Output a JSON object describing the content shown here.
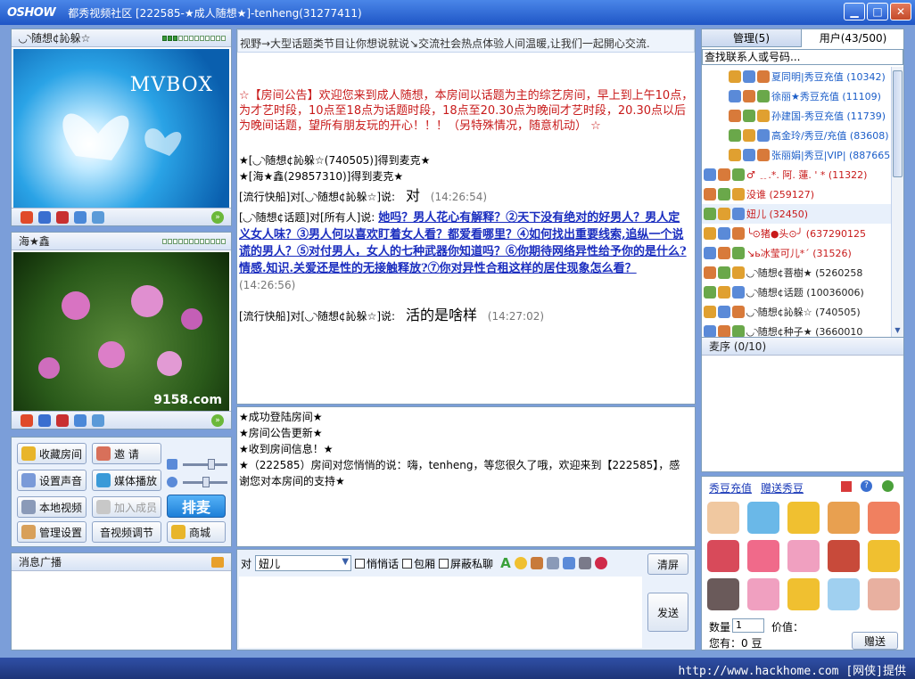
{
  "window": {
    "logo": "OSHOW",
    "title": "都秀视频社区  [222585-★成人随想★]-tenheng(31277411)",
    "buttons": [
      "▁",
      "□",
      "✕"
    ]
  },
  "video1": {
    "name": "◟◞◝随想¢訫躲☆",
    "watermark": "MVBOX"
  },
  "video2": {
    "name": "海★鑫",
    "watermark": "9158.com"
  },
  "buttons": {
    "favorite_room": "收藏房间",
    "invite": "邀   请",
    "sound_settings": "设置声音",
    "media_play": "媒体播放",
    "local_video": "本地视频",
    "join_member": "加入成员",
    "queue_mic": "排麦",
    "manage_settings": "管理设置",
    "av_adjust": "音视频调节",
    "mall": "商城"
  },
  "broadcast": {
    "title": "消息广播"
  },
  "marquee": "视野→大型话题类节目让你想说就说↘交流社会热点体验人间温暖,让我们一起開心交流.",
  "chat": {
    "announcement": "☆【房间公告】欢迎您来到成人随想，本房间以话题为主的综艺房间，早上到上午10点，为才艺时段，10点至18点为话题时段，18点至20.30点为晚间才艺时段，20.30点以后为晚间话题，望所有朋友玩的开心！！！（另特殊情况，随意机动） ☆",
    "mic1": "★[◟◞◝随想¢訫躲☆(740505)]得到麦克★",
    "mic2": "★[海★鑫(29857310)]得到麦克★",
    "msg1_prefix": "[流行快船]对[◟◞◝随想¢訫躲☆]说:",
    "msg1_text": "对",
    "msg1_time": "(14:26:54)",
    "msg2_prefix": "[◟◞◝随想¢话题]对[所有人]说:",
    "msg2_text": "她吗？男人花心有解释？②天下没有绝对的好男人？男人定义女人味？③男人何以喜欢盯着女人看？都爱看哪里？④如何找出重要线索,追纵一个说谎的男人？⑤对付男人，女人的七种武器你知道吗？⑥你期待网络异性给予你的是什么?情感.知识.关爱还是性的无接触释放?⑦你对异性合租这样的居住现象怎么看？",
    "msg2_time": "(14:26:56)",
    "msg3_prefix": "[流行快船]对[◟◞◝随想¢訫躲☆]说:",
    "msg3_text": "活的是啥样",
    "msg3_time": "(14:27:02)"
  },
  "private": {
    "line1": "★成功登陆房间★",
    "line2": "★房间公告更新★",
    "line3": "★收到房间信息！★",
    "line4": "★（222585）房间对您悄悄的说：嗨，tenheng，等您很久了哦，欢迎来到【222585】，感谢您对本房间的支持★"
  },
  "input_bar": {
    "to_label": "对",
    "target": "妞儿",
    "whisper": "悄悄话",
    "wrap": "包厢",
    "block": "屏蔽私聊",
    "clear": "清屏",
    "send": "发送"
  },
  "tabs": {
    "admin": "管理(5)",
    "users": "用户(43/500)"
  },
  "search": {
    "placeholder": "查找联系人或号码..."
  },
  "users": [
    {
      "name": "夏同明|秀豆充值 (10342)",
      "color": "#1a5dc8"
    },
    {
      "name": "徐丽★秀豆充值 (11109)",
      "color": "#1a5dc8"
    },
    {
      "name": "孙建国-秀豆充值 (11739)",
      "color": "#1a5dc8"
    },
    {
      "name": "高金玲/秀豆/充值 (83608)",
      "color": "#1a5dc8"
    },
    {
      "name": "张丽娟|秀豆|VIP| (887665)",
      "color": "#1a5dc8"
    },
    {
      "name": "♂ ﹎.*. 阿. 蓮. ' * (11322)",
      "color": "#c81a1a"
    },
    {
      "name": "没谁 (259127)",
      "color": "#c81a1a"
    },
    {
      "name": "妞儿 (32450)",
      "color": "#c81a1a"
    },
    {
      "name": "╰⊙猪●头⊙╯ (637290125",
      "color": "#c81a1a"
    },
    {
      "name": "↘ь冰莹可儿*ˊ (31526)",
      "color": "#c81a1a"
    },
    {
      "name": "◟◞◝随想¢菩樹★ (5260258",
      "color": "#222222"
    },
    {
      "name": "◟◞◝随想¢话题 (10036006)",
      "color": "#222222"
    },
    {
      "name": "◟◞◝随想¢訫躲☆ (740505)",
      "color": "#222222"
    },
    {
      "name": "◟◞◝随想¢种子★ (3660010",
      "color": "#222222"
    }
  ],
  "queue": {
    "title": "麦序 (0/10)"
  },
  "gift_panel": {
    "recharge": "秀豆充值",
    "gift": "赠送秀豆",
    "qty_label": "数量",
    "qty": "1",
    "price_label": "价值：",
    "have": "您有：0 豆",
    "give": "赠送"
  },
  "statusbar": "http://www.hackhome.com [网侠]提供"
}
